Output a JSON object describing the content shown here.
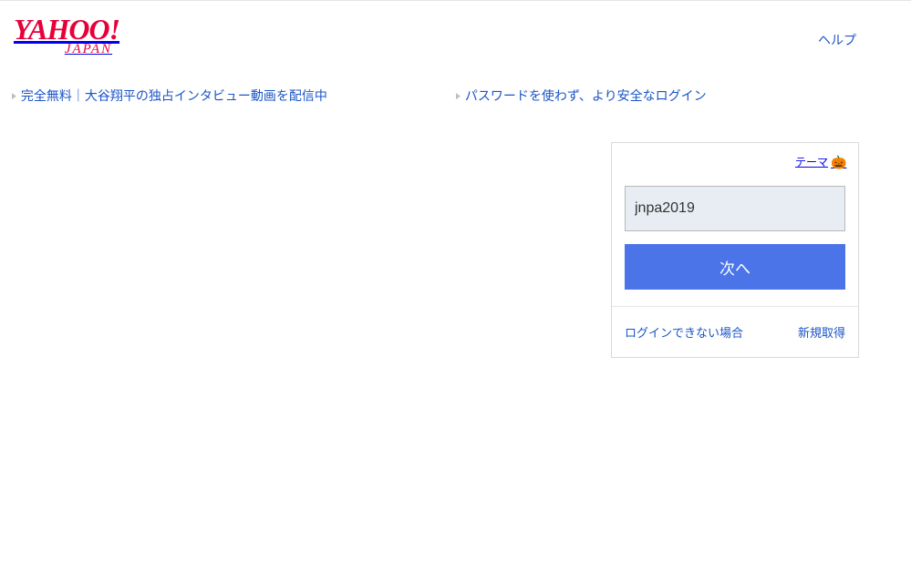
{
  "header": {
    "logo_main": "YAHOO!",
    "logo_sub": "JAPAN",
    "help": "ヘルプ"
  },
  "promos": [
    "完全無料｜大谷翔平の独占インタビュー動画を配信中",
    "パスワードを使わず、より安全なログイン"
  ],
  "login": {
    "theme_label": "テーマ",
    "id_value": "jnpa2019",
    "next_label": "次へ",
    "cannot_login": "ログインできない場合",
    "register": "新規取得"
  }
}
